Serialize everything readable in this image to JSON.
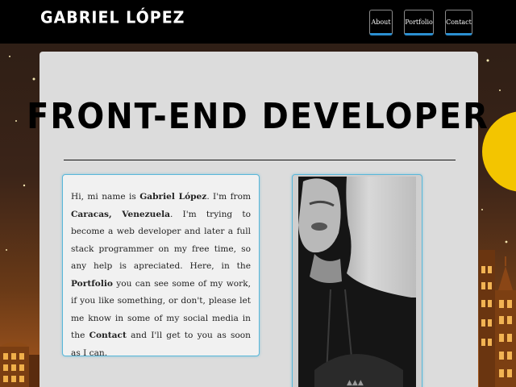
{
  "navbar": {
    "brand": "GABRIEL LÓPEZ",
    "links": [
      "About",
      "Portfolio",
      "Contact"
    ]
  },
  "main": {
    "headline": "FRONT-END DEVELOPER",
    "bio": {
      "p1": "Hi, mi name is ",
      "name": "Gabriel López",
      "p2": ". I'm from ",
      "city": "Caracas, Venezuela",
      "p3": ". I'm trying to become a web developer and later a full stack programmer on my free time, so any help is apreciated. Here, in the ",
      "portfolio": "Portfolio",
      "p4": " you can see some of my work, if you like something, or don't, please let me know in some of my social media in the ",
      "contact": "Contact",
      "p5": " and I'll get to you as soon as I can."
    }
  },
  "colors": {
    "accent": "#2b8fd1",
    "card_border": "#59b7d9",
    "card_bg": "#dcdcdc",
    "navbar_bg": "#000000",
    "moon": "#f3c500"
  }
}
